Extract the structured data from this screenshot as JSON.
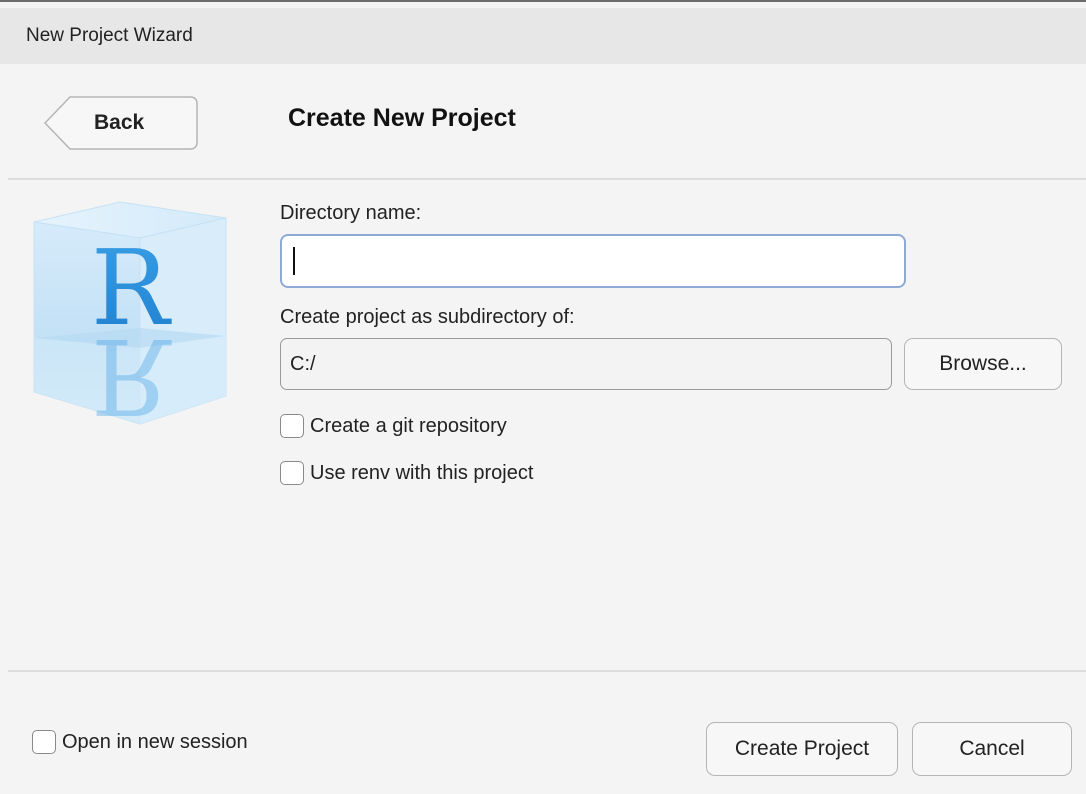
{
  "window": {
    "title": "New Project Wizard"
  },
  "header": {
    "back_label": "Back",
    "title": "Create New Project"
  },
  "logo": {
    "letter": "R",
    "icon": "r-logo-icon"
  },
  "form": {
    "directory_label": "Directory name:",
    "directory_value": "",
    "parent_label": "Create project as subdirectory of:",
    "parent_value": "C:/",
    "browse_label": "Browse...",
    "git_label": "Create a git repository",
    "git_checked": false,
    "renv_label": "Use renv with this project",
    "renv_checked": false
  },
  "footer": {
    "new_session_label": "Open in new session",
    "new_session_checked": false,
    "create_label": "Create Project",
    "cancel_label": "Cancel"
  },
  "colors": {
    "focus_border": "#8fa9d6",
    "logo_blue": "#2a8fd8"
  }
}
